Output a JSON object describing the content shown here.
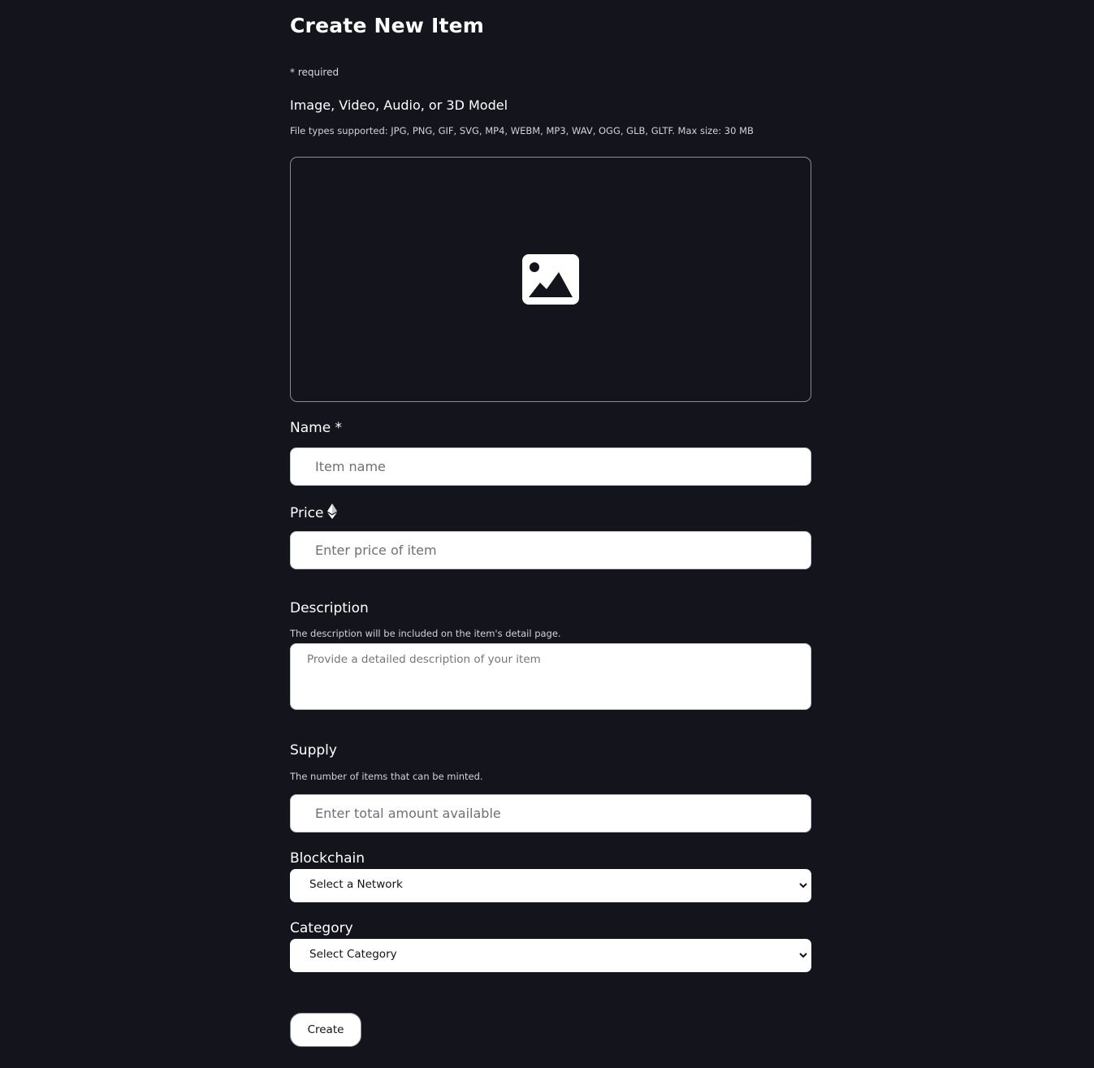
{
  "page": {
    "title": "Create New Item",
    "required_note": "* required"
  },
  "media": {
    "label": "Image, Video, Audio, or 3D Model",
    "hint": "File types supported: JPG, PNG, GIF, SVG, MP4, WEBM, MP3, WAV, OGG, GLB, GLTF. Max size: 30 MB",
    "icon": "image-icon"
  },
  "name_field": {
    "label": "Name *",
    "placeholder": "Item name"
  },
  "price_field": {
    "label": "Price",
    "icon": "ethereum-icon",
    "placeholder": "Enter price of item"
  },
  "description_field": {
    "label": "Description",
    "hint": "The description will be included on the item's detail page.",
    "placeholder": "Provide a detailed description of your item"
  },
  "supply_field": {
    "label": "Supply",
    "hint": "The number of items that can be minted.",
    "placeholder": "Enter total amount available"
  },
  "blockchain_field": {
    "label": "Blockchain",
    "selected": "Select a Network"
  },
  "category_field": {
    "label": "Category",
    "selected": "Select Category"
  },
  "actions": {
    "create_label": "Create"
  },
  "colors": {
    "background": "#14141d",
    "text": "#ffffff",
    "input_background": "#ffffff"
  }
}
